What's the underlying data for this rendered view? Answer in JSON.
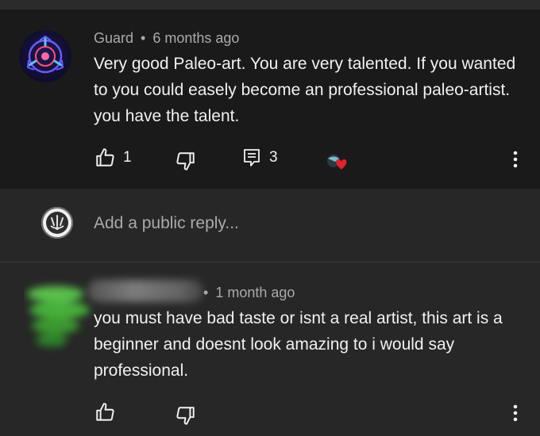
{
  "comment": {
    "author": "Guard",
    "separator": "•",
    "time": "6 months ago",
    "text": "Very good Paleo-art. You are very talented. If you wanted to you could easely become an professional paleo-artist. you have the talent.",
    "likes": "1",
    "replies": "3",
    "icons": {
      "avatar": "scp-logo-avatar",
      "like": "thumbs-up-icon",
      "dislike": "thumbs-down-icon",
      "reply": "reply-comment-icon",
      "heart": "creator-heart-icon",
      "more": "more-vert-icon"
    }
  },
  "reply_box": {
    "placeholder": "Add a public reply..."
  },
  "reply": {
    "separator": "•",
    "time": "1 month ago",
    "text": "you must have bad taste or isnt a real artist, this art is a beginner and doesnt look amazing to i would say professional.",
    "icons": {
      "like": "thumbs-up-icon",
      "dislike": "thumbs-down-icon",
      "more": "more-vert-icon"
    }
  },
  "colors": {
    "background": "#212121",
    "comment_bg": "#1a1a1a",
    "text": "#f1f1f1",
    "meta": "#aaaaaa",
    "heart": "#e3222f"
  }
}
